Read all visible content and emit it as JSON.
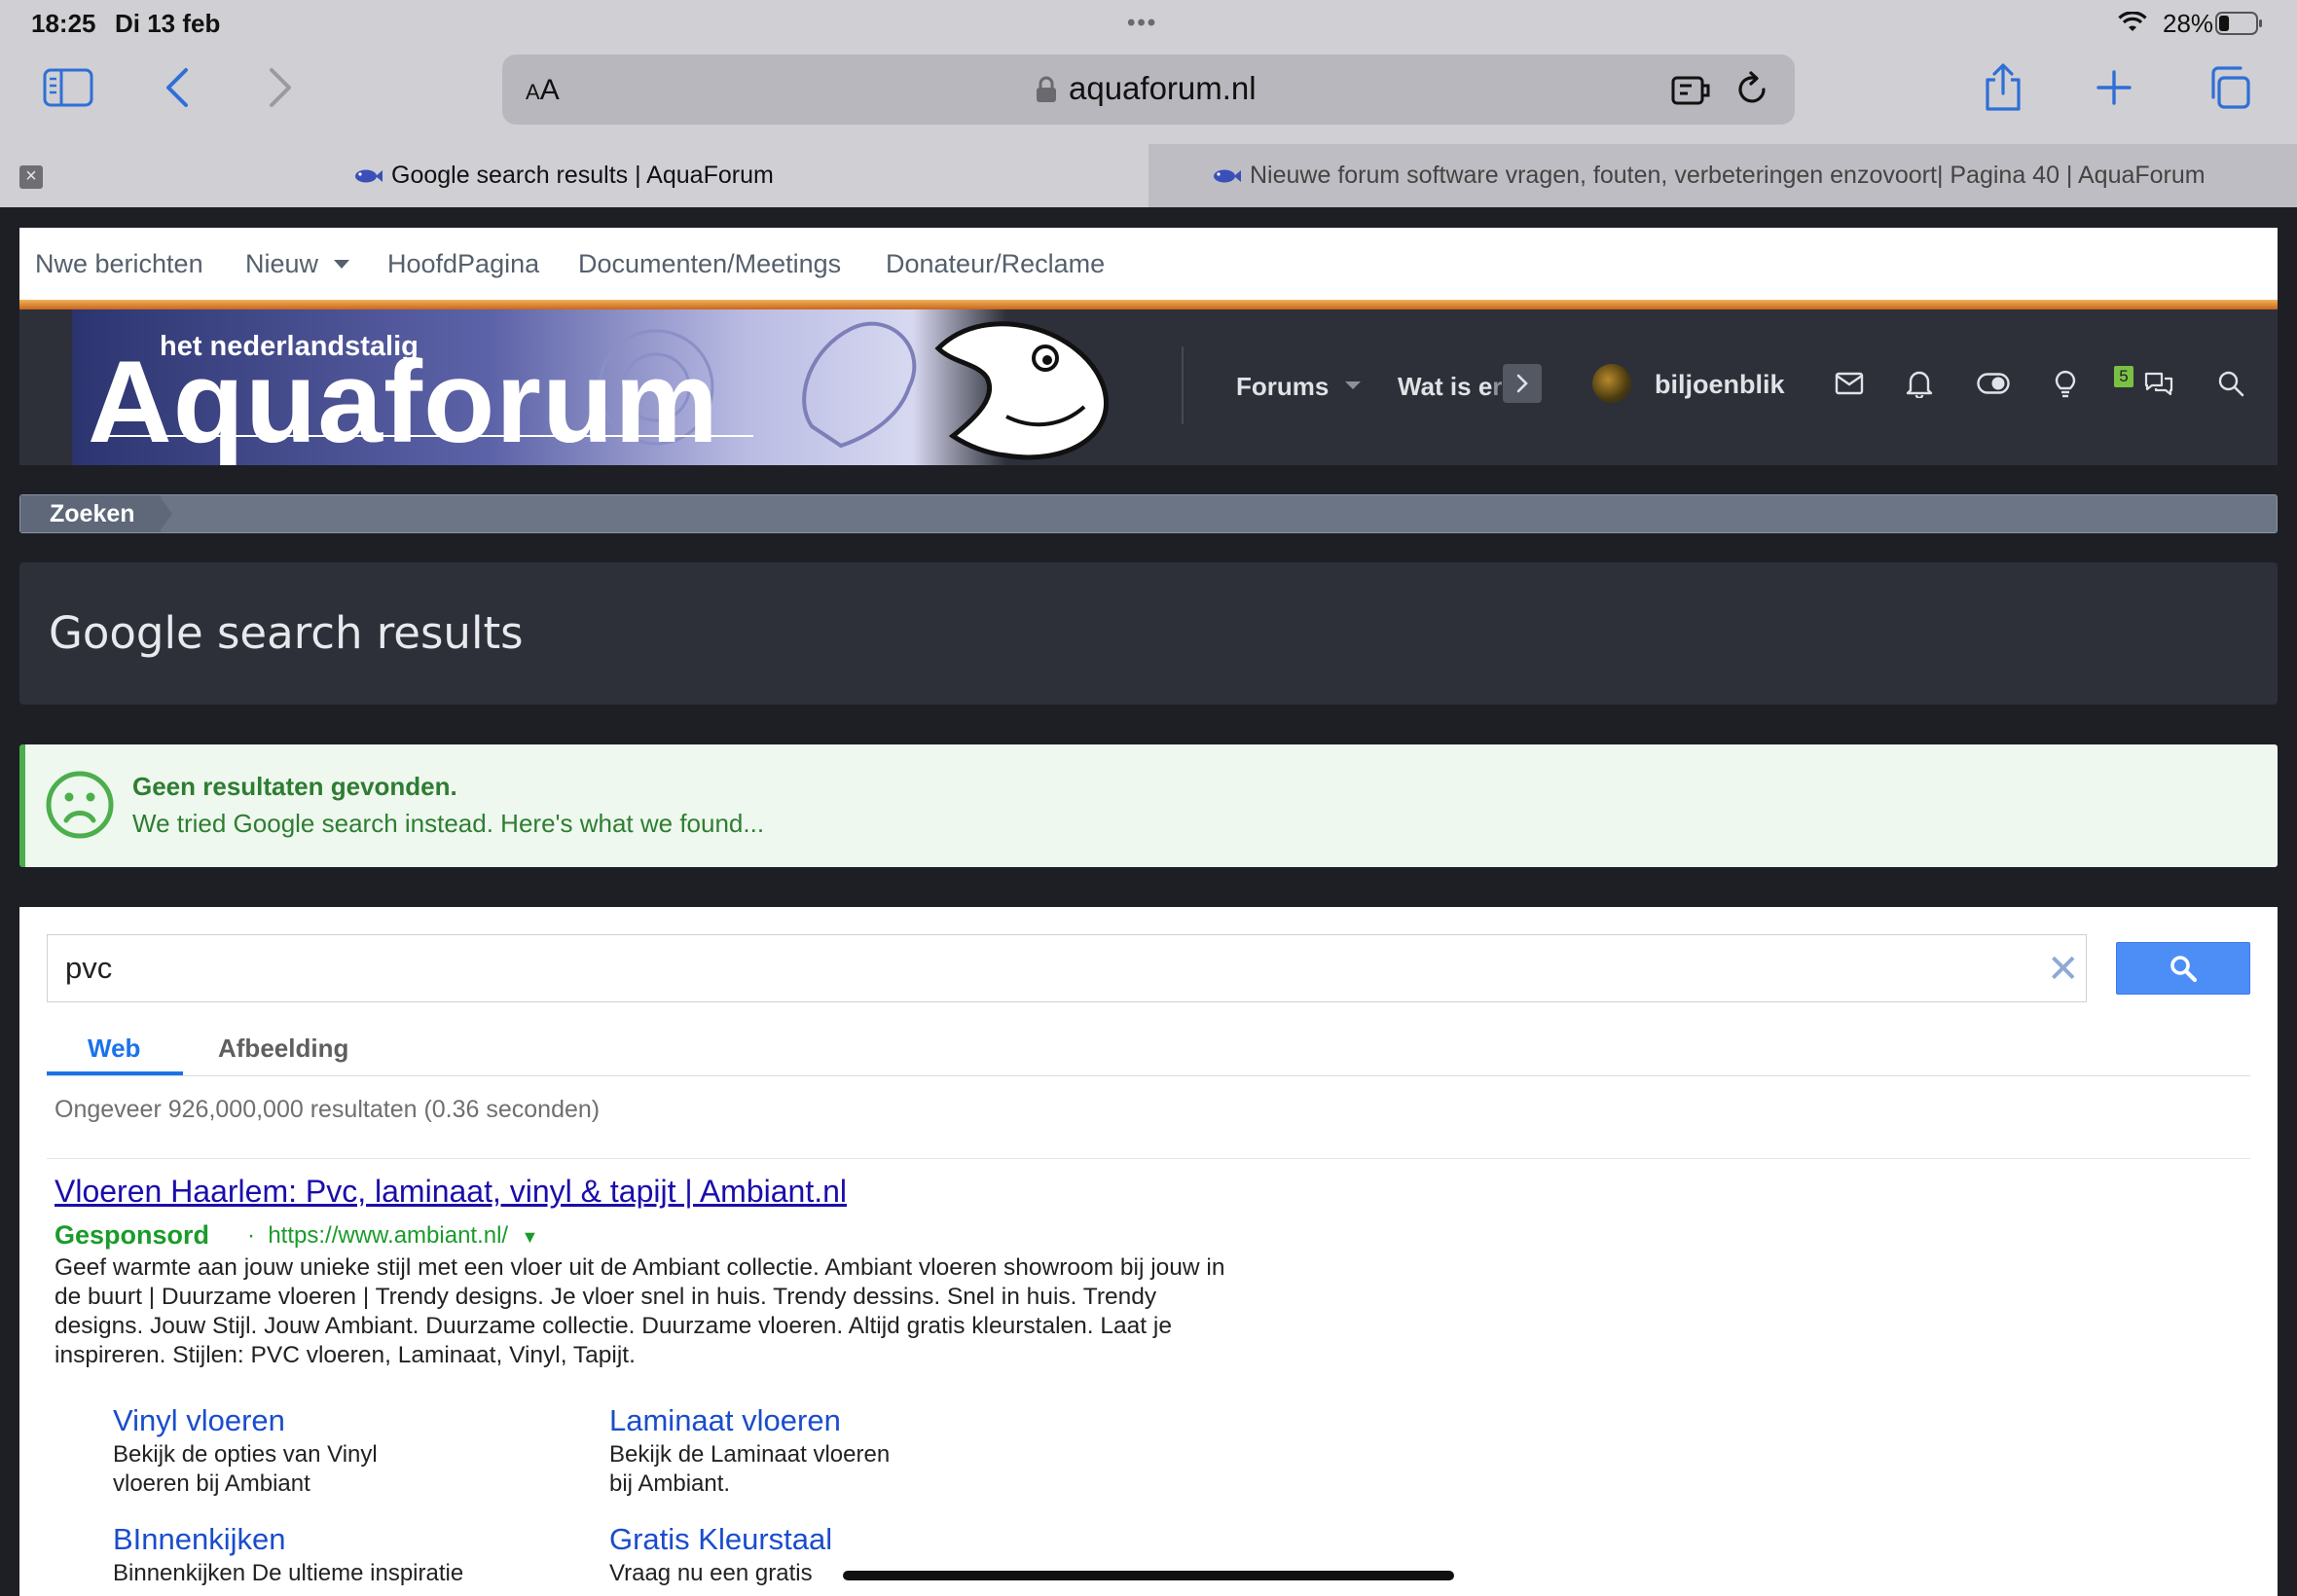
{
  "status": {
    "time": "18:25",
    "date": "Di 13 feb",
    "battery": "28%",
    "battery_level": 0.28
  },
  "address": {
    "aa_label": "AA",
    "url": "aquaforum.nl"
  },
  "tabs": [
    {
      "title": "Google search results | AquaForum",
      "active": true
    },
    {
      "title": "Nieuwe forum software vragen, fouten, verbeteringen enzovoort| Pagina 40 | AquaForum",
      "active": false
    }
  ],
  "topnav": {
    "items": [
      "Nwe berichten",
      "Nieuw",
      "HoofdPagina",
      "Documenten/Meetings",
      "Donateur/Reclame"
    ]
  },
  "header": {
    "banner_subtitle": "het nederlandstalig",
    "banner_title": "Aquaforum",
    "forums": "Forums",
    "watis_a": "Wat is e",
    "watis_b": "r",
    "username": "biljoenblik",
    "conversations_badge": "5"
  },
  "breadcrumb": {
    "label": "Zoeken"
  },
  "page": {
    "title": "Google search results"
  },
  "notice": {
    "strong": "Geen resultaten gevonden.",
    "text": "We tried Google search instead. Here's what we found..."
  },
  "google": {
    "query": "pvc",
    "tabs": [
      "Web",
      "Afbeelding"
    ],
    "result_count": "Ongeveer 926,000,000 resultaten (0.36 seconden)",
    "ad": {
      "title": "Vloeren Haarlem: Pvc, laminaat, vinyl & tapijt | Ambiant.nl",
      "label": "Gesponsord",
      "url": "https://www.ambiant.nl/",
      "description": "Geef warmte aan jouw unieke stijl met een vloer uit de Ambiant collectie. Ambiant vloeren showroom bij jouw in de buurt | Duurzame vloeren | Trendy designs. Je vloer snel in huis. Trendy dessins. Snel in huis. Trendy designs. Jouw Stijl. Jouw Ambiant. Duurzame collectie. Duurzame vloeren. Altijd gratis kleurstalen. Laat je inspireren. Stijlen: PVC vloeren, Laminaat, Vinyl, Tapijt."
    },
    "sitelinks": [
      {
        "title": "Vinyl vloeren",
        "desc1": "Bekijk de opties van Vinyl",
        "desc2": "vloeren bij Ambiant"
      },
      {
        "title": "Laminaat vloeren",
        "desc1": "Bekijk de Laminaat vloeren",
        "desc2": "bij Ambiant."
      },
      {
        "title": "BInnenkijken",
        "desc1": "Binnenkijken De ultieme inspiratie",
        "desc2": ""
      },
      {
        "title": "Gratis Kleurstaal",
        "desc1": "Vraag nu een gratis",
        "desc2": ""
      }
    ]
  },
  "colors": {
    "accent_orange": "#d9822b",
    "header_bg": "#2d3039",
    "success_green": "#2e7d32",
    "google_blue": "#4d8ef6",
    "link_blue": "#1a0dab"
  },
  "icons": [
    "sidebar-icon",
    "back-icon",
    "forward-icon",
    "lock-icon",
    "extension-icon",
    "reload-icon",
    "share-icon",
    "new-tab-icon",
    "tabs-icon",
    "envelope-icon",
    "bell-icon",
    "toggle-icon",
    "lightbulb-icon",
    "conversations-icon",
    "search-icon",
    "sad-face-icon"
  ]
}
